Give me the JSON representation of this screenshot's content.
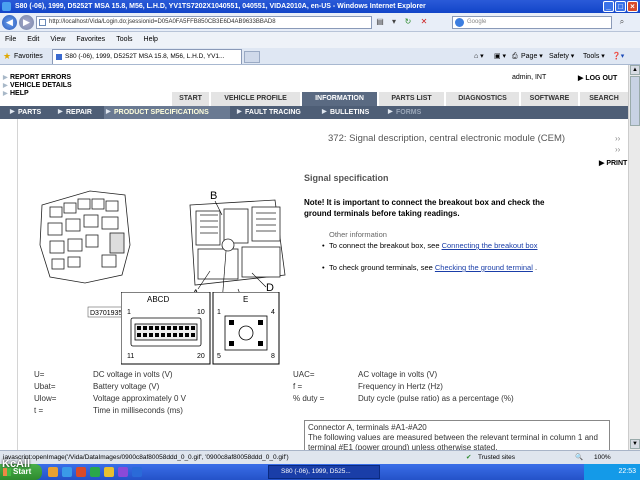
{
  "window": {
    "title": "S80 (-06), 1999, D5252T MSA 15.8, M56, L.H.D, YV1TS7202X1040551, 040551, VIDA2010A, en-US - Windows Internet Explorer"
  },
  "address": {
    "url": "http://localhost/Vida/Login.do;jsessionid=D05A0FA5FFB850CB3E6D4AB9633BBAD8",
    "search_placeholder": "Google"
  },
  "menu": [
    "File",
    "Edit",
    "View",
    "Favorites",
    "Tools",
    "Help"
  ],
  "favorites": {
    "label": "Favorites",
    "tab_title": "S80 (-06), 1999, D5252T MSA 15.8, M56, L.H.D, YV1..."
  },
  "commandbar": {
    "page": "Page",
    "safety": "Safety",
    "tools": "Tools"
  },
  "page": {
    "top_links": [
      "REPORT ERRORS",
      "VEHICLE DETAILS",
      "HELP"
    ],
    "user": "admin, INT",
    "logout": "LOG OUT",
    "main_tabs": [
      "START",
      "VEHICLE PROFILE",
      "INFORMATION",
      "PARTS LIST",
      "DIAGNOSTICS",
      "SOFTWARE",
      "SEARCH"
    ],
    "sub_tabs": [
      "PARTS",
      "REPAIR",
      "PRODUCT SPECIFICATIONS",
      "FAULT TRACING",
      "BULLETINS",
      "FORMS"
    ],
    "heading": "372: Signal description, central electronic module (CEM)",
    "print": "PRINT",
    "section": "Signal specification",
    "note": "Note! It is important to connect the breakout box and check the ground terminals before taking readings.",
    "other_info": "Other information",
    "bullet1_prefix": "To connect the breakout box, see ",
    "bullet1_link": "Connecting the breakout box",
    "bullet2_prefix": "To check ground terminals, see ",
    "bullet2_link": "Checking the ground terminal",
    "bullet2_suffix": " .",
    "figure": {
      "id_label": "D3701935",
      "conn_letters": [
        "A",
        "B",
        "C",
        "D",
        "E"
      ],
      "box1_title": "ABCD",
      "box1_pins": [
        "1",
        "10",
        "11",
        "20"
      ],
      "box2_title": "E",
      "box2_pins": [
        "1",
        "4",
        "5",
        "8"
      ]
    },
    "defs_left": [
      {
        "sym": "U=",
        "desc": "DC voltage in volts (V)"
      },
      {
        "sym": "Ubat=",
        "desc": "Battery voltage (V)"
      },
      {
        "sym": "Ulow=",
        "desc": "Voltage approximately 0 V"
      },
      {
        "sym": "t =",
        "desc": "Time in milliseconds (ms)"
      }
    ],
    "defs_right": [
      {
        "sym": "UAC=",
        "desc": "AC voltage in volts (V)"
      },
      {
        "sym": "f =",
        "desc": "Frequency in Hertz (Hz)"
      },
      {
        "sym": "% duty =",
        "desc": "Duty cycle (pulse ratio) as a percentage (%)"
      }
    ],
    "conn_box": {
      "line1": "Connector A, terminals #A1-#A20",
      "line2": "The following values are measured between the relevant terminal in column 1 and terminal #E1 (power ground) unless otherwise stated."
    }
  },
  "status": {
    "text": "javascript:openImage('/Vida/DataImages/0900c8af80058ddd_0_0.gif', '0900c8af80058ddd_0_0.gif')",
    "zone": "Trusted sites",
    "zoom": "100%"
  },
  "taskbar": {
    "start": "Start",
    "item": "S80 (-06), 1999, D525...",
    "clock": "22:53"
  },
  "watermark": "KcAll"
}
